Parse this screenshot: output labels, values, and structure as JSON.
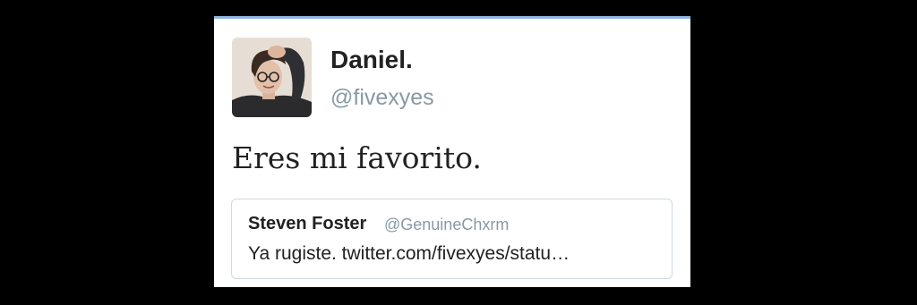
{
  "tweet": {
    "author": {
      "display_name": "Daniel.",
      "handle": "@fivexyes",
      "avatar_icon": "profile-photo"
    },
    "text": "Eres mi favorito.",
    "quoted_tweet": {
      "display_name": "Steven Foster",
      "handle": "@GenuineChxrm",
      "text": "Ya rugiste. twitter.com/fivexyes/statu…"
    }
  },
  "colors": {
    "background": "#000000",
    "card": "#ffffff",
    "accent_border": "#8fb7e0",
    "secondary_text": "#8899a6",
    "quote_border": "#cfd9de"
  }
}
